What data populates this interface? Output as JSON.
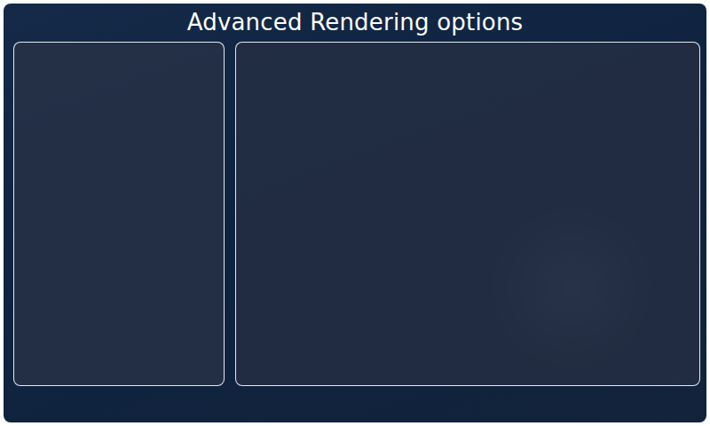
{
  "window": {
    "title": "Advanced Rendering options"
  },
  "panels": [
    {
      "kind": "narrow"
    },
    {
      "kind": "wide"
    }
  ]
}
